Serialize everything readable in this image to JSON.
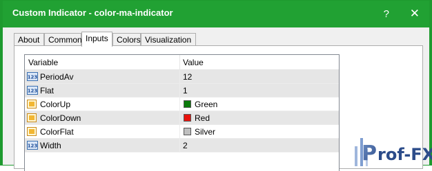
{
  "window": {
    "title": "Custom Indicator - color-ma-indicator",
    "help_glyph": "?",
    "close_glyph": "✕",
    "accent": "#21a133"
  },
  "tabs": [
    {
      "label": "About"
    },
    {
      "label": "Common"
    },
    {
      "label": "Inputs",
      "active": true
    },
    {
      "label": "Colors"
    },
    {
      "label": "Visualization"
    }
  ],
  "grid": {
    "headers": {
      "variable": "Variable",
      "value": "Value"
    },
    "rows": [
      {
        "icon": "numeric-icon",
        "name": "PeriodAv",
        "value": "12"
      },
      {
        "icon": "numeric-icon",
        "name": "Flat",
        "value": "1"
      },
      {
        "icon": "color-icon",
        "name": "ColorUp",
        "value": "Green",
        "swatch": "#0a7a0a"
      },
      {
        "icon": "color-icon",
        "name": "ColorDown",
        "value": "Red",
        "swatch": "#e8120c"
      },
      {
        "icon": "color-icon",
        "name": "ColorFlat",
        "value": "Silver",
        "swatch": "#bfbfbf"
      },
      {
        "icon": "numeric-icon",
        "name": "Width",
        "value": "2"
      }
    ]
  },
  "watermark": {
    "text": "Prof-FX"
  }
}
